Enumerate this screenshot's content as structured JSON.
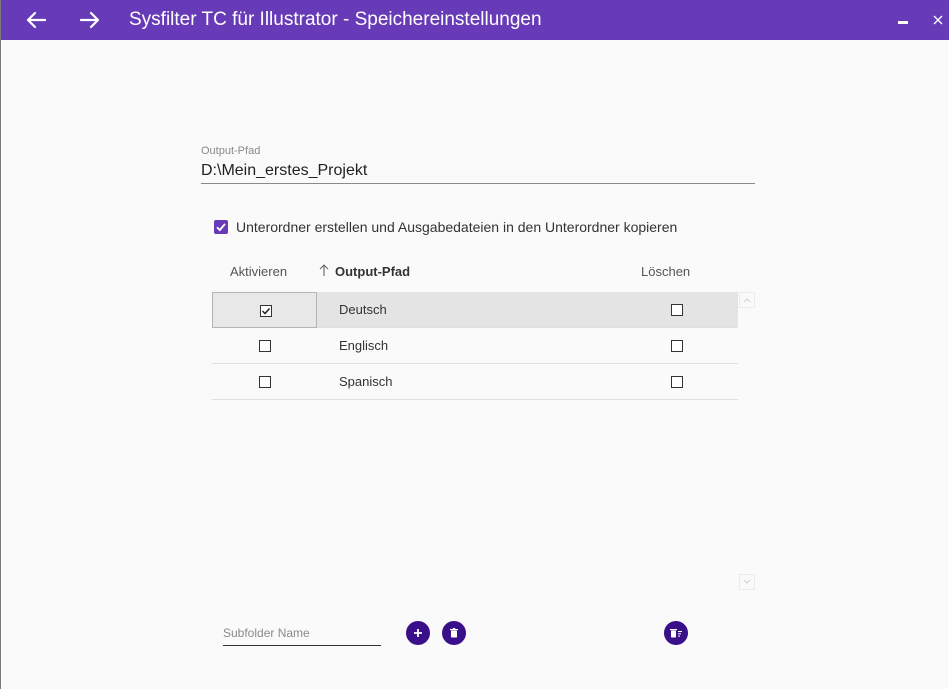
{
  "window": {
    "title": "Sysfilter TC für Illustrator - Speichereinstellungen",
    "accent_color": "#673ab7",
    "fab_color": "#3a0f8a",
    "icons": {
      "back": "arrow-left-icon",
      "forward": "arrow-right-icon",
      "minimize": "minimize-icon",
      "close": "close-icon"
    }
  },
  "output_path": {
    "label": "Output-Pfad",
    "value": "D:\\Mein_erstes_Projekt"
  },
  "subfolder_option": {
    "checked": true,
    "label": "Unterordner erstellen und Ausgabedateien in den Unterordner kopieren"
  },
  "table": {
    "headers": {
      "activate": "Aktivieren",
      "sort_icon": "sort-ascending-icon",
      "output_path": "Output-Pfad",
      "delete": "Löschen"
    },
    "rows": [
      {
        "name": "Deutsch",
        "active": true,
        "delete": false,
        "selected": true
      },
      {
        "name": "Englisch",
        "active": false,
        "delete": false,
        "selected": false
      },
      {
        "name": "Spanisch",
        "active": false,
        "delete": false,
        "selected": false
      }
    ]
  },
  "footer": {
    "subfolder_name_placeholder": "Subfolder Name",
    "subfolder_name_value": "",
    "icons": {
      "add": "plus-icon",
      "delete": "trash-icon",
      "delete_selected": "delete-sweep-icon"
    }
  }
}
